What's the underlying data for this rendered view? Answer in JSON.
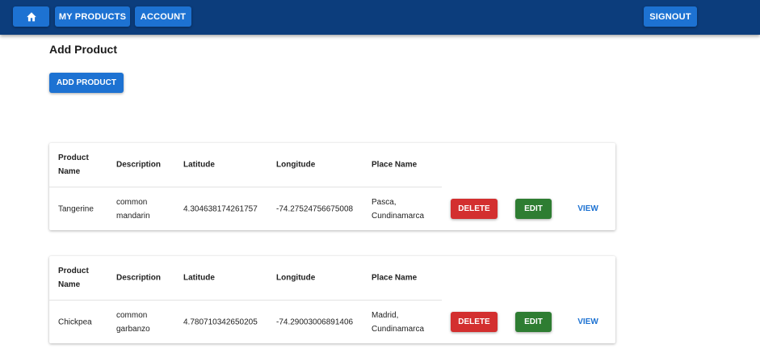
{
  "nav": {
    "home_icon": "home-icon",
    "my_products": "MY PRODUCTS",
    "account": "ACCOUNT",
    "signout": "SIGNOUT"
  },
  "page": {
    "title": "Add Product",
    "add_button": "ADD PRODUCT"
  },
  "table": {
    "headers": [
      "Product Name",
      "Description",
      "Latitude",
      "Longitude",
      "Place Name"
    ],
    "actions": {
      "delete": "DELETE",
      "edit": "EDIT",
      "view": "VIEW"
    }
  },
  "products": [
    {
      "name": "Tangerine",
      "description": "common mandarin",
      "latitude": "4.304638174261757",
      "longitude": "-74.27524756675008",
      "place": "Pasca, Cundinamarca"
    },
    {
      "name": "Chickpea",
      "description": "common garbanzo",
      "latitude": "4.780710342650205",
      "longitude": "-74.29003006891406",
      "place": "Madrid, Cundinamarca"
    }
  ],
  "colors": {
    "appbar": "#0c3d7c",
    "primary": "#1d72d2",
    "delete": "#d32f2f",
    "edit": "#2e7d32"
  }
}
